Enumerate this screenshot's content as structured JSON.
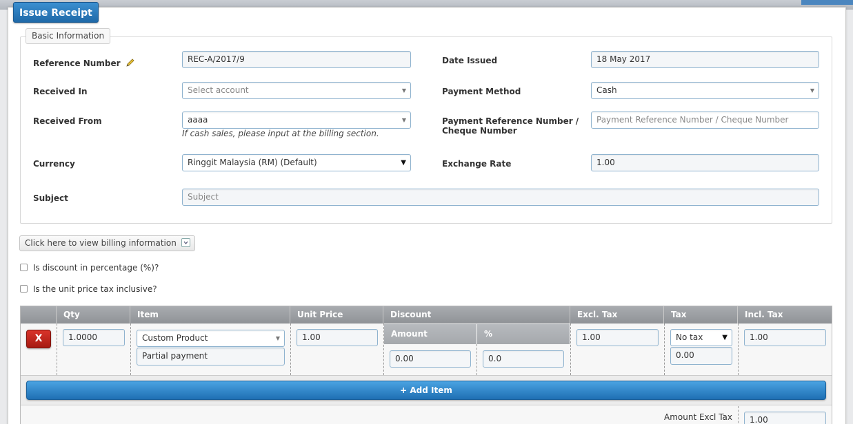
{
  "window": {
    "title": "Issue Receipt"
  },
  "basic_information": {
    "legend": "Basic Information",
    "reference_number": {
      "label": "Reference Number",
      "value": "REC-A/2017/9"
    },
    "date_issued": {
      "label": "Date Issued",
      "value": "18 May 2017"
    },
    "received_in": {
      "label": "Received In",
      "placeholder": "Select account"
    },
    "payment_method": {
      "label": "Payment Method",
      "value": "Cash"
    },
    "received_from": {
      "label": "Received From",
      "value": "aaaa",
      "hint": "If cash sales, please input at the billing section."
    },
    "payment_reference": {
      "label_line1": "Payment Reference Number /",
      "label_line2": "Cheque Number",
      "placeholder": "Payment Reference Number / Cheque Number"
    },
    "currency": {
      "label": "Currency",
      "value": "Ringgit Malaysia (RM) (Default)"
    },
    "exchange_rate": {
      "label": "Exchange Rate",
      "value": "1.00"
    },
    "subject": {
      "label": "Subject",
      "placeholder": "Subject"
    }
  },
  "billing_button": {
    "label": "Click here to view billing information"
  },
  "options": {
    "discount_percentage": "Is discount in percentage (%)?",
    "tax_inclusive": "Is the unit price tax inclusive?"
  },
  "items_table": {
    "headers": {
      "qty": "Qty",
      "item": "Item",
      "unit_price": "Unit Price",
      "discount": "Discount",
      "discount_amount": "Amount",
      "discount_percent": "%",
      "excl_tax": "Excl. Tax",
      "tax": "Tax",
      "incl_tax": "Incl. Tax"
    },
    "row": {
      "delete_label": "X",
      "qty": "1.0000",
      "item": "Custom Product",
      "description": "Partial payment",
      "unit_price": "1.00",
      "discount_amount": "0.00",
      "discount_percent": "0.0",
      "excl_tax": "1.00",
      "tax_option": "No tax",
      "tax_amount": "0.00",
      "incl_tax": "1.00"
    },
    "add_item_label": "+ Add Item"
  },
  "totals": {
    "amount_excl_tax_label": "Amount Excl Tax",
    "amount_excl_tax_value": "1.00"
  },
  "colors": {
    "accent": "#1f69a8",
    "danger": "#c0281f",
    "header_gray": "#9a9da1"
  }
}
